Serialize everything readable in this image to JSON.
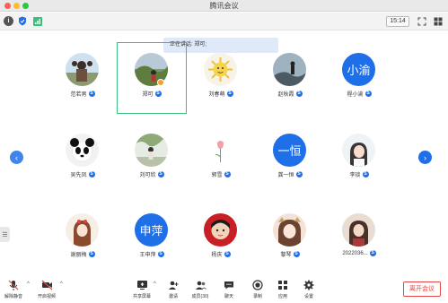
{
  "window": {
    "title": "腾讯会议"
  },
  "toolbar": {
    "time": "15:14"
  },
  "speaking": {
    "text": "正在讲话: 郑可;"
  },
  "participants": [
    {
      "name": "范若男"
    },
    {
      "name": "郑可"
    },
    {
      "name": "刘春萌"
    },
    {
      "name": "赵秋霞"
    },
    {
      "name": "程小渝",
      "avatar_text": "小渝"
    },
    {
      "name": "吴先凤"
    },
    {
      "name": "刘可欣"
    },
    {
      "name": "郭雪"
    },
    {
      "name": "龚一恒",
      "avatar_text": "一恒"
    },
    {
      "name": "李琰"
    },
    {
      "name": "谢丽梅"
    },
    {
      "name": "王申萍",
      "avatar_text": "申萍"
    },
    {
      "name": "杨庆"
    },
    {
      "name": "黎琴"
    },
    {
      "name": "2022036..."
    }
  ],
  "badge_text": "S",
  "bottombar": {
    "mute_label": "解除静音",
    "video_label": "开启视频",
    "share_label": "共享屏幕",
    "invite_label": "邀请",
    "members_label": "成员(30)",
    "chat_label": "聊天",
    "record_label": "录制",
    "apps_label": "应用",
    "settings_label": "设置",
    "leave_label": "离开会议"
  },
  "colors": {
    "accent": "#1e6fe8",
    "active_border": "#3cbf7a",
    "leave": "#e54545"
  }
}
